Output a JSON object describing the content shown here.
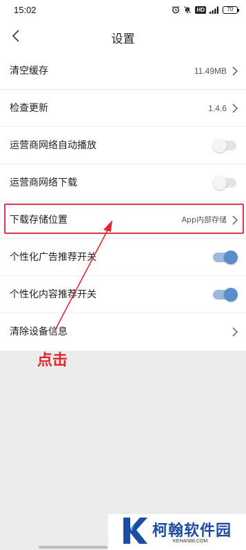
{
  "status_bar": {
    "time": "15:02",
    "hd_badge": "HD",
    "battery": "70",
    "icons": [
      "alarm-icon",
      "mute-icon",
      "hd-icon",
      "signal-icon",
      "battery-icon"
    ]
  },
  "header": {
    "title": "设置",
    "back_icon": "chevron-left-icon"
  },
  "settings": {
    "items": [
      {
        "label": "清空缓存",
        "value": "11.49MB",
        "control": "chevron"
      },
      {
        "label": "检查更新",
        "value": "1.4.6",
        "control": "chevron"
      },
      {
        "label": "运营商网络自动播放",
        "control": "toggle",
        "on": false
      },
      {
        "label": "运营商网络下载",
        "control": "toggle",
        "on": false
      },
      {
        "label": "下载存储位置",
        "value": "App内部存储",
        "control": "chevron",
        "highlighted": true
      },
      {
        "label": "个性化广告推荐开关",
        "control": "toggle",
        "on": true
      },
      {
        "label": "个性化内容推荐开关",
        "control": "toggle",
        "on": true
      },
      {
        "label": "清除设备信息",
        "control": "chevron"
      }
    ]
  },
  "annotation": {
    "text": "点击",
    "color": "#e0262e"
  },
  "watermark": {
    "name": "柯翰软件园",
    "url": "KEHAN88.COM",
    "color": "#1d4da3"
  },
  "colors": {
    "toggle_on": "#5a8dcc",
    "toggle_off": "#f5f5f5",
    "highlight": "#e0334a",
    "background": "#ececec"
  }
}
